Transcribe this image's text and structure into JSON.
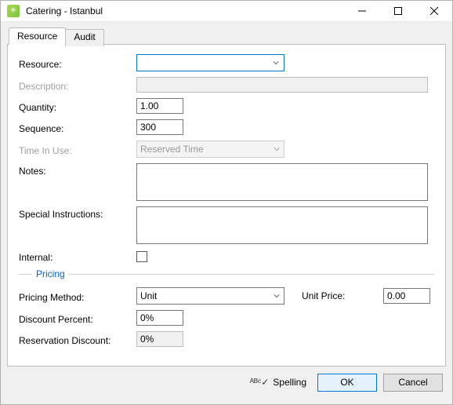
{
  "window": {
    "title": "Catering - Istanbul"
  },
  "tabs": [
    {
      "label": "Resource",
      "active": true
    },
    {
      "label": "Audit",
      "active": false
    }
  ],
  "form": {
    "resource": {
      "label": "Resource:",
      "value": ""
    },
    "description": {
      "label": "Description:",
      "value": ""
    },
    "quantity": {
      "label": "Quantity:",
      "value": "1.00"
    },
    "sequence": {
      "label": "Sequence:",
      "value": "300"
    },
    "time_in_use": {
      "label": "Time In Use:",
      "value": "Reserved Time"
    },
    "notes": {
      "label": "Notes:",
      "value": ""
    },
    "special_instructions": {
      "label": "Special Instructions:",
      "value": ""
    },
    "internal": {
      "label": "Internal:",
      "checked": false
    }
  },
  "pricing": {
    "legend": "Pricing",
    "method": {
      "label": "Pricing Method:",
      "value": "Unit"
    },
    "unit_price": {
      "label": "Unit Price:",
      "value": "0.00"
    },
    "discount_percent": {
      "label": "Discount Percent:",
      "value": "0%"
    },
    "reservation_discount": {
      "label": "Reservation Discount:",
      "value": "0%"
    }
  },
  "footer": {
    "spelling": "Spelling",
    "ok": "OK",
    "cancel": "Cancel"
  }
}
